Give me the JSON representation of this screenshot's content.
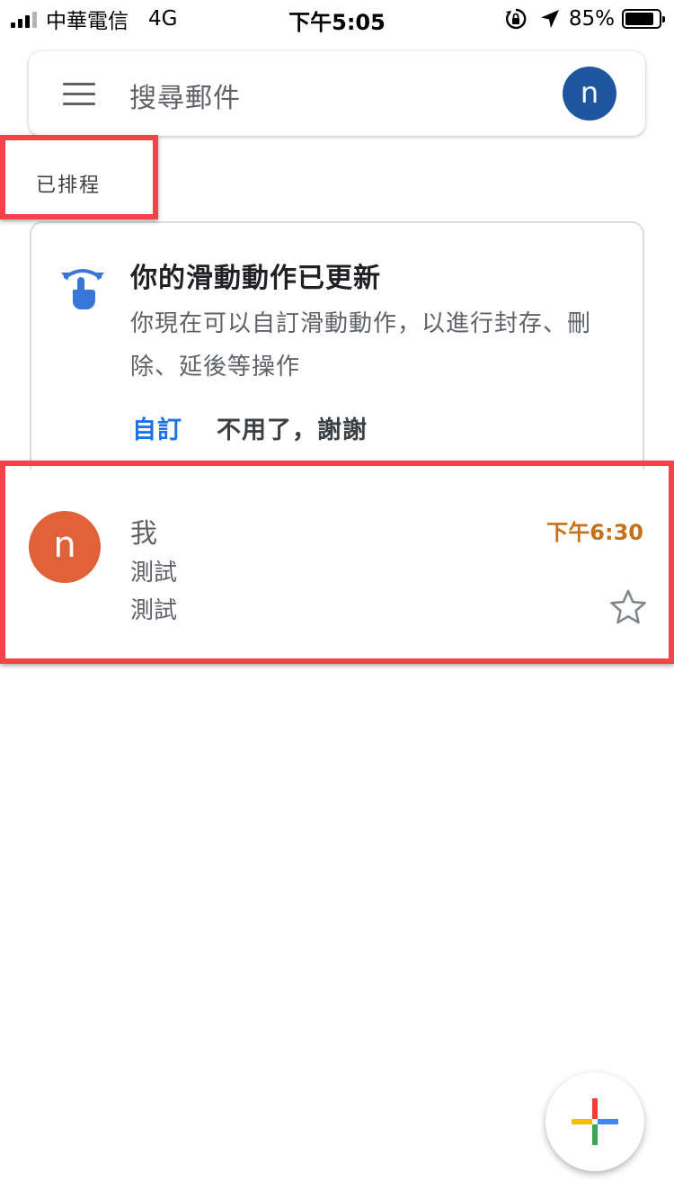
{
  "status_bar": {
    "carrier": "中華電信",
    "network": "4G",
    "time": "下午5:05",
    "battery_percent": "85%",
    "battery_level": 0.85
  },
  "search": {
    "placeholder": "搜尋郵件",
    "avatar_letter": "n",
    "avatar_color": "#1e56a0"
  },
  "section": {
    "label": "已排程"
  },
  "tip_card": {
    "title": "你的滑動動作已更新",
    "body": "你現在可以自訂滑動動作，以進行封存、刪除、延後等操作",
    "action_primary": "自訂",
    "action_secondary": "不用了，謝謝",
    "icon": "swipe-gesture-icon"
  },
  "emails": [
    {
      "avatar_letter": "n",
      "avatar_color": "#e0613a",
      "sender": "我",
      "subject": "測試",
      "snippet": "測試",
      "time": "下午6:30",
      "starred": false
    }
  ],
  "colors": {
    "accent_blue": "#1a73e8",
    "highlight_red": "#f2434a",
    "time_orange": "#c5711b"
  },
  "fab": {
    "icon": "compose-plus-icon"
  }
}
